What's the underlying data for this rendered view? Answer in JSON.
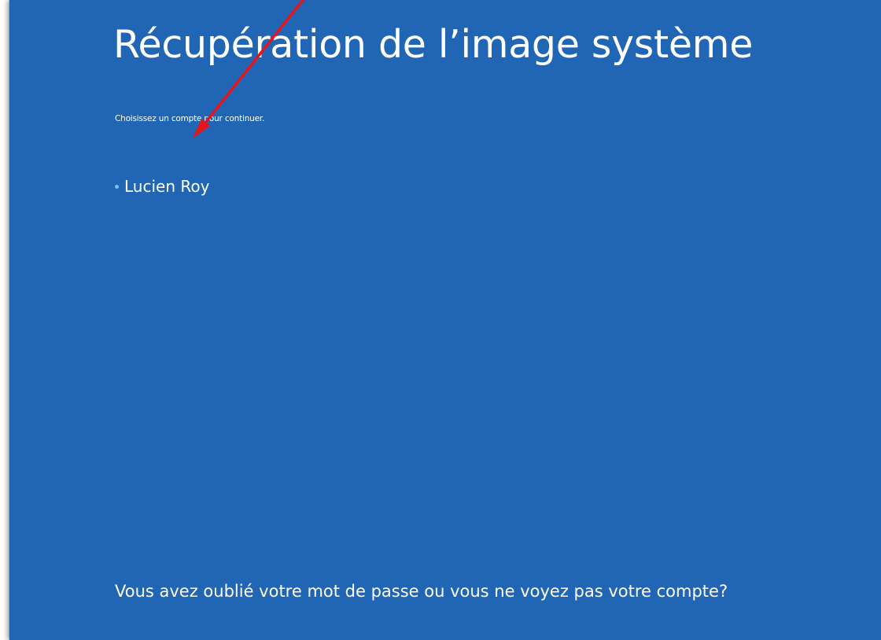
{
  "page": {
    "title": "Récupération de l’image système",
    "subtitle": "Choisissez un compte pour continuer.",
    "accounts": [
      {
        "name": "Lucien Roy"
      }
    ],
    "forgot_link": "Vous avez oublié votre mot de passe ou vous ne voyez pas votre compte?"
  },
  "colors": {
    "background": "#2166b4",
    "text": "#ffffff",
    "bullet": "#73c2f0",
    "annotation_arrow": "#e8141b"
  },
  "icons": {
    "account_bullet": "bullet-dot-icon",
    "annotation": "red-arrow-icon"
  }
}
